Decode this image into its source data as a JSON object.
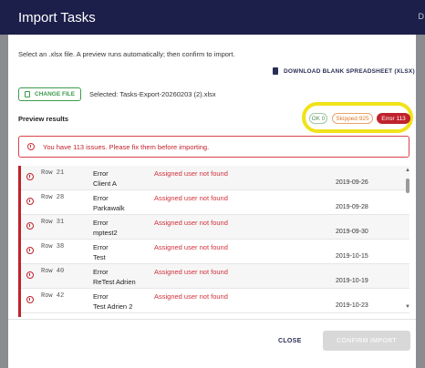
{
  "background": {
    "right_label": "D"
  },
  "dialog": {
    "title": "Import Tasks",
    "instruction": "Select an .xlsx file. A preview runs automatically; then confirm to import.",
    "download_label": "DOWNLOAD BLANK SPREADSHEET (XLSX)",
    "change_file_label": "CHANGE FILE",
    "selected_file": "Selected: Tasks-Export-20260203 (2).xlsx",
    "preview_title": "Preview results",
    "badges": {
      "ok": "OK 0",
      "skipped": "Skipped 925",
      "error": "Error 113"
    },
    "alert_text": "You have 113 issues. Please fix them before importing.",
    "rows": [
      {
        "row": "Row 21",
        "level": "Error",
        "message": "Assigned user not found",
        "name": "Client A",
        "date": "2019-09-26"
      },
      {
        "row": "Row 28",
        "level": "Error",
        "message": "Assigned user not found",
        "name": "Parkawalk",
        "date": "2019-09-28"
      },
      {
        "row": "Row 31",
        "level": "Error",
        "message": "Assigned user not found",
        "name": "mptest2",
        "date": "2019-09-30"
      },
      {
        "row": "Row 38",
        "level": "Error",
        "message": "Assigned user not found",
        "name": "Test",
        "date": "2019-10-15"
      },
      {
        "row": "Row 40",
        "level": "Error",
        "message": "Assigned user not found",
        "name": "ReTest Adrien",
        "date": "2019-10-19"
      },
      {
        "row": "Row 42",
        "level": "Error",
        "message": "Assigned user not found",
        "name": "Test Adrien 2",
        "date": "2019-10-23"
      }
    ],
    "close_label": "CLOSE",
    "confirm_label": "CONFIRM IMPORT"
  },
  "colors": {
    "header": "#1b1f4a",
    "error": "#c0222b",
    "success": "#3c9b4a",
    "warning": "#e07a2a",
    "highlight": "#f1e21a"
  }
}
